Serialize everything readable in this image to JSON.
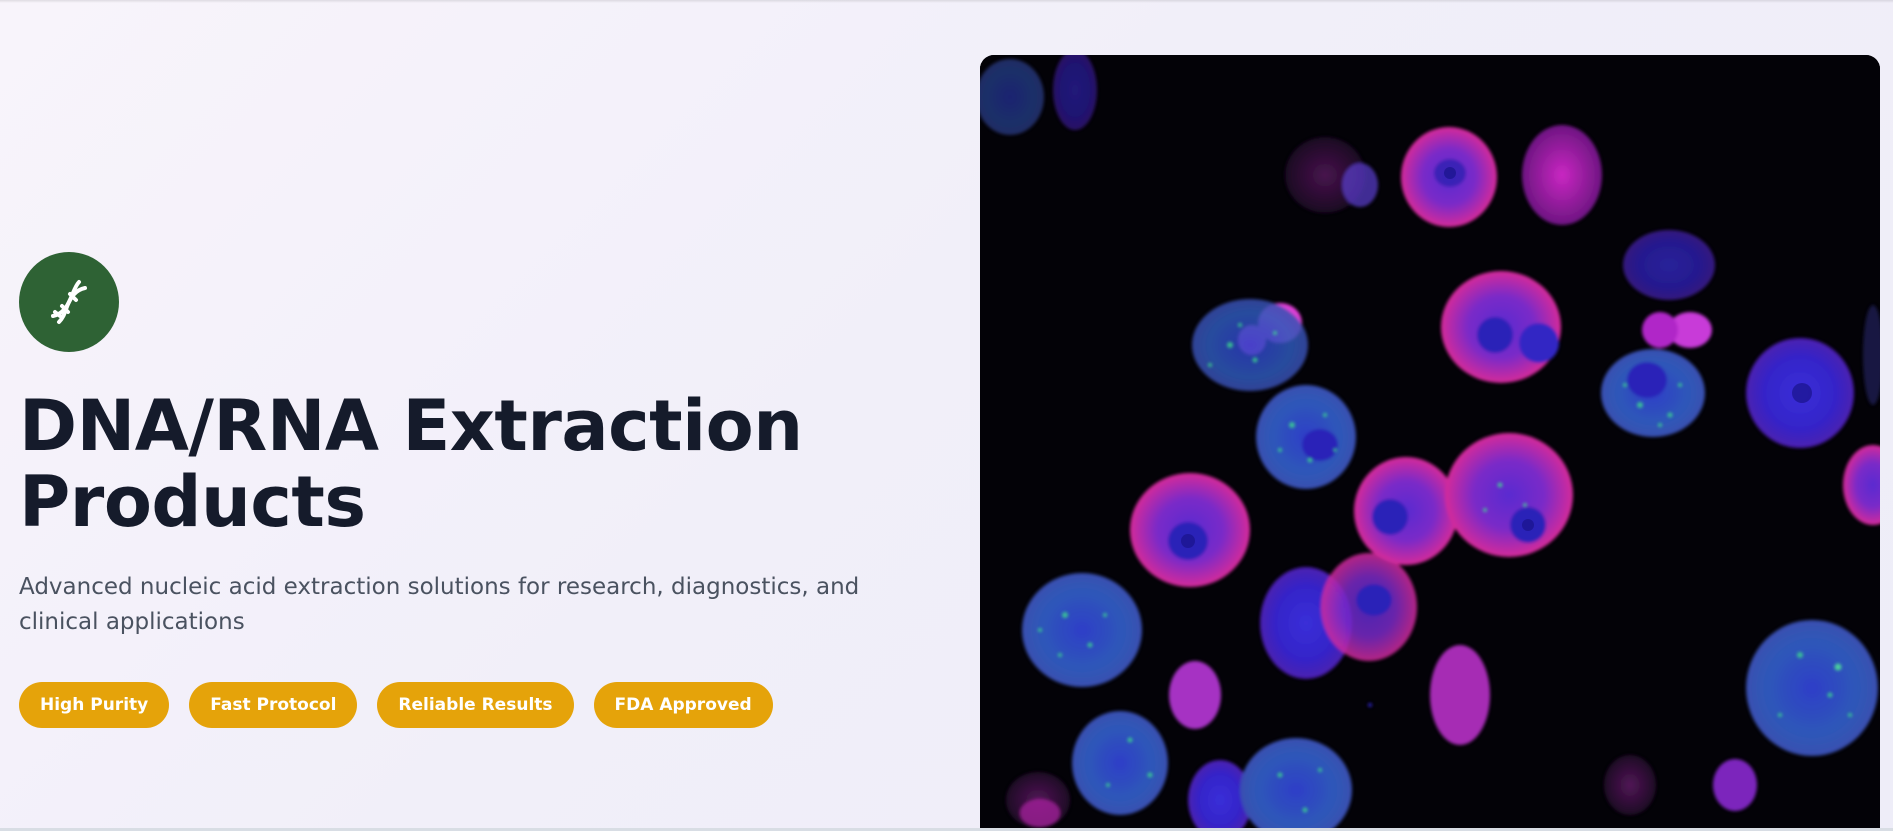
{
  "hero": {
    "icon": "dna-icon",
    "title_line1": "DNA/RNA Extraction",
    "title_line2": "Products",
    "subtitle": "Advanced nucleic acid extraction solutions for research, diagnostics, and clinical applications",
    "tags": [
      "High Purity",
      "Fast Protocol",
      "Reliable Results",
      "FDA Approved"
    ],
    "image": "fluorescence-microscopy-cells-image"
  },
  "colors": {
    "icon_bg": "#2e6234",
    "tag_bg": "#e5a30a",
    "title": "#151b2b",
    "subtitle": "#4a5260"
  }
}
